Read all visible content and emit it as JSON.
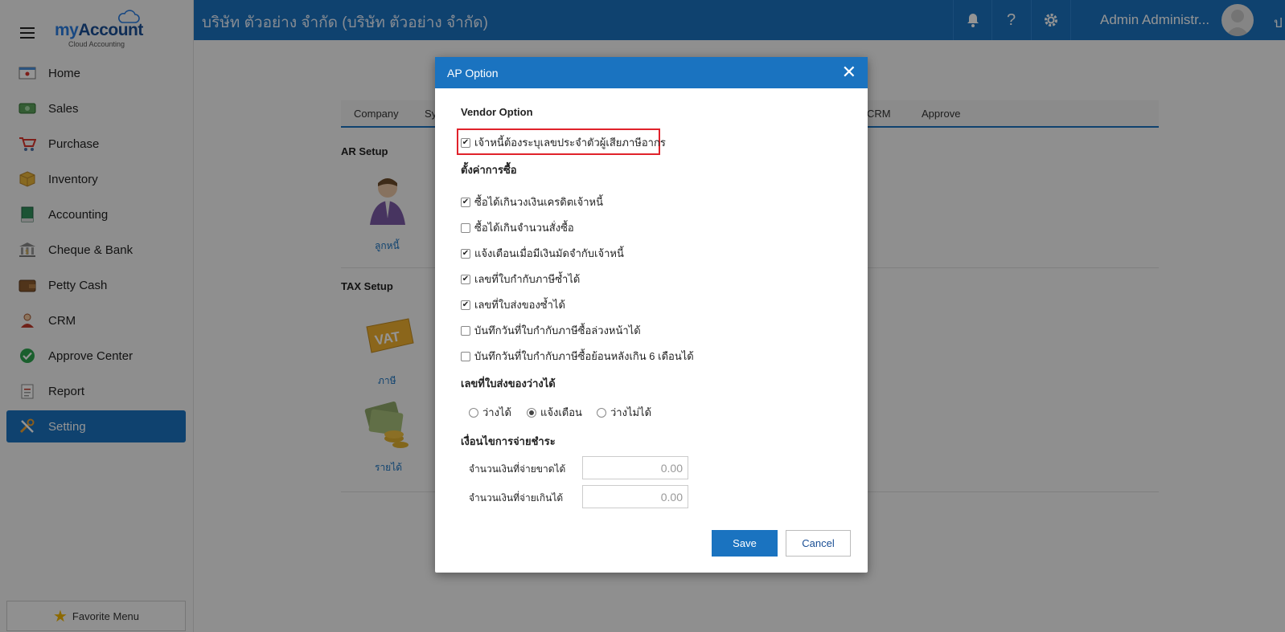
{
  "header": {
    "company": "บริษัท ตัวอย่าง จำกัด (บริษัท ตัวอย่าง จำกัด)",
    "user": "Admin Administr...",
    "more": "ป"
  },
  "logo": {
    "brand_my": "my",
    "brand_account": "Account",
    "sub": "Cloud Accounting"
  },
  "sidebar": {
    "items": [
      {
        "label": "Home",
        "icon": "home-icon"
      },
      {
        "label": "Sales",
        "icon": "sales-icon"
      },
      {
        "label": "Purchase",
        "icon": "cart-icon"
      },
      {
        "label": "Inventory",
        "icon": "box-icon"
      },
      {
        "label": "Accounting",
        "icon": "book-icon"
      },
      {
        "label": "Cheque & Bank",
        "icon": "bank-icon"
      },
      {
        "label": "Petty Cash",
        "icon": "wallet-icon"
      },
      {
        "label": "CRM",
        "icon": "crm-icon"
      },
      {
        "label": "Approve Center",
        "icon": "check-circle-icon"
      },
      {
        "label": "Report",
        "icon": "report-icon"
      },
      {
        "label": "Setting",
        "icon": "tools-icon",
        "active": true
      }
    ],
    "favorite": "Favorite Menu"
  },
  "content": {
    "tabs": [
      "Company",
      "Sy",
      "CRM",
      "Approve"
    ],
    "ar_setup": "AR Setup",
    "ar_link": "ลูกหนี้",
    "tax_setup": "TAX Setup",
    "tax_link": "ภาษี",
    "vat_text": "VAT",
    "income_link": "รายได้"
  },
  "modal": {
    "title": "AP Option",
    "vendor_option": "Vendor Option",
    "vendor_tax_id": "เจ้าหนี้ต้องระบุเลขประจำตัวผู้เสียภาษีอากร",
    "purchase_settings": "ตั้งค่าการซื้อ",
    "options": [
      {
        "label": "ซื้อได้เกินวงเงินเครดิตเจ้าหนี้",
        "checked": true
      },
      {
        "label": "ซื้อได้เกินจำนวนสั่งซื้อ",
        "checked": false
      },
      {
        "label": "แจ้งเตือนเมื่อมีเงินมัดจำกับเจ้าหนี้",
        "checked": true
      },
      {
        "label": "เลขที่ใบกำกับภาษีซ้ำได้",
        "checked": true
      },
      {
        "label": "เลขที่ใบส่งของซ้ำได้",
        "checked": true
      },
      {
        "label": "บันทึกวันที่ใบกำกับภาษีซื้อล่วงหน้าได้",
        "checked": false
      },
      {
        "label": "บันทึกวันที่ใบกำกับภาษีซื้อย้อนหลังเกิน 6 เดือนได้",
        "checked": false
      }
    ],
    "blank_delivery": "เลขที่ใบส่งของว่างได้",
    "radios": [
      {
        "label": "ว่างได้",
        "selected": false
      },
      {
        "label": "แจ้งเตือน",
        "selected": true
      },
      {
        "label": "ว่างไม่ได้",
        "selected": false
      }
    ],
    "payment_terms": "เงื่อนไขการจ่ายชำระ",
    "underpay_label": "จำนวนเงินที่จ่ายขาดได้",
    "underpay_value": "0.00",
    "overpay_label": "จำนวนเงินที่จ่ายเกินได้",
    "overpay_value": "0.00",
    "save": "Save",
    "cancel": "Cancel"
  }
}
